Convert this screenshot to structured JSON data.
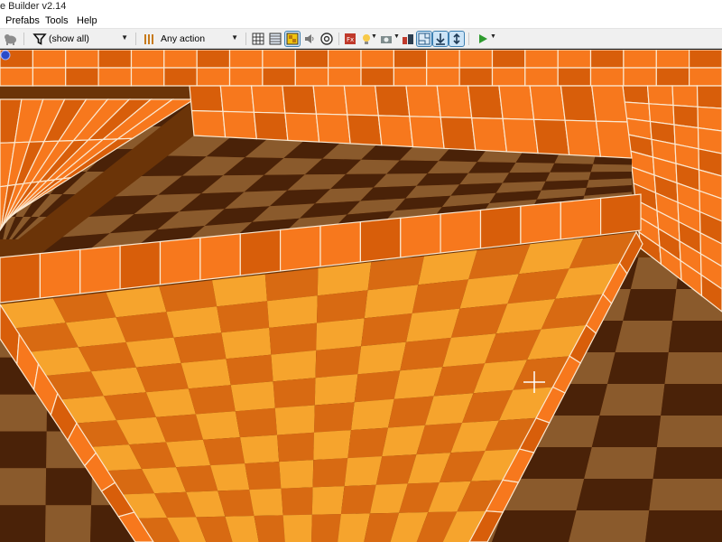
{
  "window": {
    "title": "e Builder v2.14"
  },
  "menu": {
    "items": [
      "Prefabs",
      "Tools",
      "Help"
    ]
  },
  "toolbar": {
    "filter_value": "(show all)",
    "action_value": "Any action",
    "filter_icon": "funnel-icon",
    "action_icon": "bars-icon",
    "colors": {
      "accent": "#3c7fb1",
      "play": "#2e9b2e",
      "fx": "#c0392b"
    }
  },
  "viewport": {
    "colors": {
      "wall": "#f7781d",
      "wall_dark": "#d85e0a",
      "floor_light": "#f6a42d",
      "floor_dark": "#d86a12",
      "floor_far_light": "#8a5a2c",
      "floor_far_dark": "#4a2208",
      "seam": "#fbe8d0"
    }
  }
}
